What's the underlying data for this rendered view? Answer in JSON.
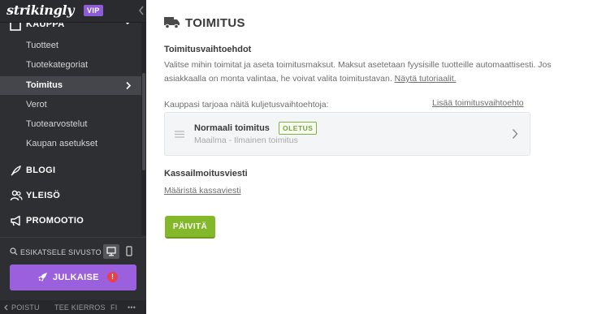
{
  "sidebar": {
    "logo": "strikingly",
    "vip": "VIP",
    "section_label": "KAUPPA",
    "sub_items": [
      {
        "label": "Tuotteet"
      },
      {
        "label": "Tuotekategoriat"
      },
      {
        "label": "Toimitus"
      },
      {
        "label": "Verot"
      },
      {
        "label": "Tuotearvostelut"
      },
      {
        "label": "Kaupan asetukset"
      }
    ],
    "main_items": [
      {
        "label": "BLOGI",
        "icon": "quill-icon"
      },
      {
        "label": "YLEISÖ",
        "icon": "audience-icon"
      },
      {
        "label": "PROMOOTIO",
        "icon": "megaphone-icon"
      }
    ],
    "preview_label": "ESIKATSELE SIVUSTO",
    "publish_label": "JULKAISE",
    "publish_warning": "!",
    "footer": {
      "exit": "POISTU",
      "tour": "TEE KIERROS",
      "lang": "FI",
      "more": "•••"
    }
  },
  "main": {
    "title": "TOIMITUS",
    "options_title": "Toimitusvaihtoehdot",
    "description": "Valitse mihin toimitat ja aseta toimitusmaksut. Maksut asetetaan fyysisille tuotteille automaattisesti. Jos asiakkaalla on monta valintaa, he voivat valita toimitustavan.",
    "tutorial_link": "Näytä tutoriaalit.",
    "store_offers": "Kauppasi tarjoaa näitä kuljetusvaihtoehtoja:",
    "add_option": "Lisää toimitusvaihtoehto",
    "shipping_option": {
      "name": "Normaali toimitus",
      "badge": "OLETUS",
      "detail": "Maailma - Ilmainen toimitus"
    },
    "checkout_title": "Kassailmoitusviesti",
    "checkout_link": "Määristä kassaviesti",
    "update_button": "PÄIVITÄ"
  },
  "colors": {
    "sidebar_bg": "#2e2f33",
    "vip_purple": "#8e5cd6",
    "publish_purple": "#9a60dd",
    "update_green": "#83b82a",
    "badge_green": "#79b536"
  }
}
